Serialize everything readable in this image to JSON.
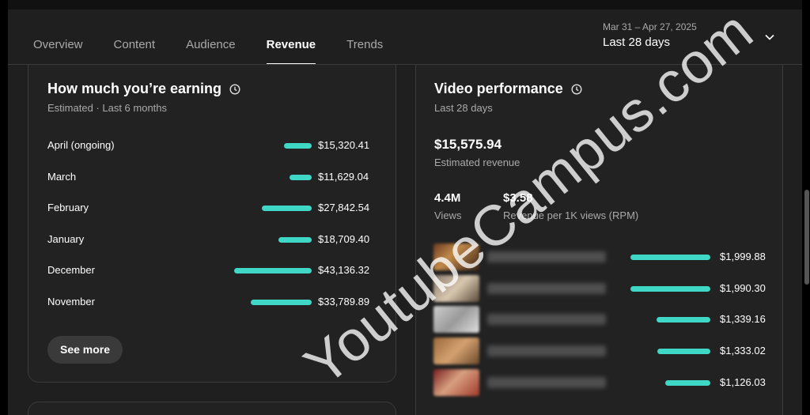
{
  "tabs": [
    "Overview",
    "Content",
    "Audience",
    "Revenue",
    "Trends"
  ],
  "active_tab": "Revenue",
  "date_range": {
    "sub": "Mar 31 – Apr 27, 2025",
    "main": "Last 28 days"
  },
  "earning": {
    "title": "How much you’re earning",
    "subtitle": "Estimated · Last 6 months",
    "rows": [
      {
        "label": "April (ongoing)",
        "amount": "$15,320.41",
        "value": 15320.41
      },
      {
        "label": "March",
        "amount": "$11,629.04",
        "value": 11629.04
      },
      {
        "label": "February",
        "amount": "$27,842.54",
        "value": 27842.54
      },
      {
        "label": "January",
        "amount": "$18,709.40",
        "value": 18709.4
      },
      {
        "label": "December",
        "amount": "$43,136.32",
        "value": 43136.32
      },
      {
        "label": "November",
        "amount": "$33,789.89",
        "value": 33789.89
      }
    ],
    "see_more": "See more"
  },
  "performance": {
    "title": "Video performance",
    "subtitle": "Last 28 days",
    "revenue": "$15,575.94",
    "revenue_label": "Estimated revenue",
    "views": "4.4M",
    "views_label": "Views",
    "rpm": "$3.58",
    "rpm_label": "Revenue per 1K views (RPM)",
    "videos": [
      {
        "amount": "$1,999.88",
        "value": 1999.88
      },
      {
        "amount": "$1,990.30",
        "value": 1990.3
      },
      {
        "amount": "$1,339.16",
        "value": 1339.16
      },
      {
        "amount": "$1,333.02",
        "value": 1333.02
      },
      {
        "amount": "$1,126.03",
        "value": 1126.03
      }
    ]
  },
  "watermark": "YoutubeCampus.com",
  "colors": {
    "bar": "#3fd7c6",
    "background": "#1f1f1f",
    "card": "#222222"
  }
}
